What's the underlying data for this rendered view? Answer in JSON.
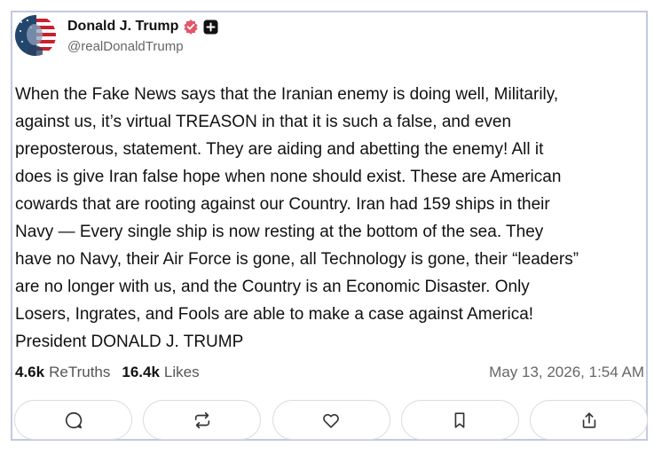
{
  "author": {
    "display_name": "Donald J. Trump",
    "handle": "@realDonaldTrump",
    "verified_badge_icon": "verified-badge-icon",
    "plus_icon": "plus-square-icon"
  },
  "post": {
    "text": "When the Fake News says that the Iranian enemy is doing well, Militarily,\nagainst us, it’s virtual TREASON in that it is such a false, and even\npreposterous, statement. They are aiding and abetting the enemy! All it\ndoes is give Iran false hope when none should exist. These are American\ncowards that are rooting against our Country. Iran had 159 ships in their\nNavy — Every single ship is now resting at the bottom of the sea. They\nhave no Navy, their Air Force is gone, all Technology is gone, their “leaders”\nare no longer with us, and the Country is an Economic Disaster. Only\nLosers, Ingrates, and Fools are able to make a case against America!\nPresident DONALD J. TRUMP"
  },
  "stats": {
    "retruths_count": "4.6k",
    "retruths_label": "ReTruths",
    "likes_count": "16.4k",
    "likes_label": "Likes",
    "timestamp": "May 13, 2026, 1:54 AM"
  },
  "actions": [
    {
      "icon": "reply-icon"
    },
    {
      "icon": "retruth-icon"
    },
    {
      "icon": "like-icon"
    },
    {
      "icon": "bookmark-icon"
    },
    {
      "icon": "share-icon"
    }
  ],
  "colors": {
    "card_border": "#c3c9e2",
    "badge": "#e2566c",
    "secondary_text": "#666666"
  }
}
